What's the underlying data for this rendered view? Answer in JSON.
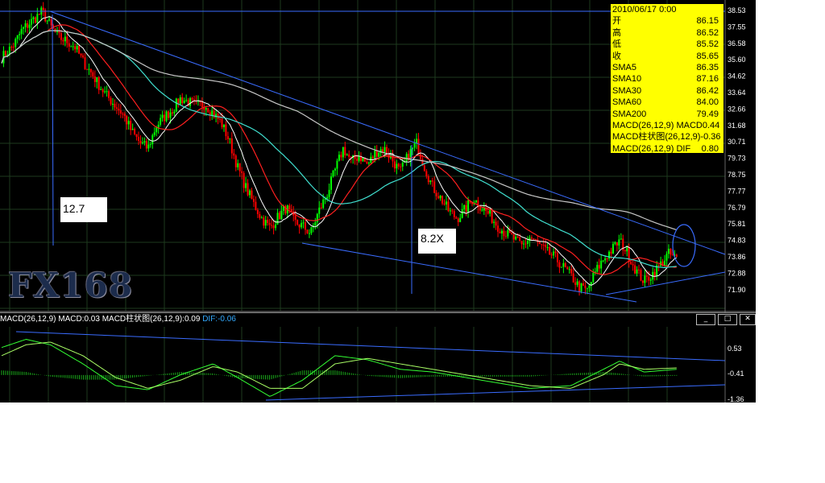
{
  "info_panel": {
    "date": "2010/06/17 0:00",
    "rows": [
      {
        "label": "开",
        "value": "86.15"
      },
      {
        "label": "高",
        "value": "86.52"
      },
      {
        "label": "低",
        "value": "85.52"
      },
      {
        "label": "收",
        "value": "85.65"
      },
      {
        "label": "SMA5",
        "value": "86.35"
      },
      {
        "label": "SMA10",
        "value": "87.16"
      },
      {
        "label": "SMA30",
        "value": "86.42"
      },
      {
        "label": "SMA60",
        "value": "84.00"
      },
      {
        "label": "SMA200",
        "value": "79.49"
      },
      {
        "label": "MACD(26,12,9) MACD",
        "value": "0.44"
      },
      {
        "label": "MACD柱状图(26,12,9)",
        "value": "-0.36"
      },
      {
        "label": "MACD(26,12,9) DIF",
        "value": "0.80"
      }
    ]
  },
  "annotations": {
    "left_note": "12.7",
    "right_note": "8.2X"
  },
  "logo_text": "FX168",
  "macd_header": {
    "main": "MACD(26,12,9) MACD:0.03 MACD柱状图(26,12,9):0.09",
    "dif": "DIF:-0.06"
  },
  "window_buttons": {
    "minimize": "_",
    "maximize": "□",
    "close": "✕"
  },
  "colors": {
    "background": "#000000",
    "up": "#00ff00",
    "down": "#ff0000",
    "sma5": "#ffffff",
    "sma10": "#ff2020",
    "sma30": "#40e0d0",
    "sma200": "#c8c8c8",
    "trendline": "#3a6cff",
    "info_bg": "#ffff00"
  },
  "chart_data": [
    {
      "type": "candlestick",
      "series": [
        "SMA5",
        "SMA10",
        "SMA30",
        "SMA200"
      ],
      "y_ticks": [
        "38.53",
        "37.55",
        "36.58",
        "35.60",
        "34.62",
        "33.64",
        "32.66",
        "31.68",
        "30.71",
        "79.73",
        "78.75",
        "77.77",
        "76.79",
        "75.81",
        "74.83",
        "73.86",
        "72.88",
        "71.90"
      ],
      "x_range": [
        0,
        170
      ],
      "ylim": [
        71.9,
        88.1
      ],
      "close_path": [
        [
          0,
          85.5
        ],
        [
          3,
          86.2
        ],
        [
          5,
          87.0
        ],
        [
          8,
          87.6
        ],
        [
          10,
          88.0
        ],
        [
          12,
          87.2
        ],
        [
          14,
          86.6
        ],
        [
          16,
          86.4
        ],
        [
          18,
          86.1
        ],
        [
          20,
          85.3
        ],
        [
          22,
          84.7
        ],
        [
          24,
          84.0
        ],
        [
          26,
          83.4
        ],
        [
          28,
          82.9
        ],
        [
          30,
          82.4
        ],
        [
          32,
          81.5
        ],
        [
          34,
          80.9
        ],
        [
          36,
          80.6
        ],
        [
          38,
          81.8
        ],
        [
          40,
          82.3
        ],
        [
          42,
          82.7
        ],
        [
          44,
          83.3
        ],
        [
          46,
          83.1
        ],
        [
          48,
          82.9
        ],
        [
          50,
          83.0
        ],
        [
          52,
          82.5
        ],
        [
          54,
          82.0
        ],
        [
          56,
          81.0
        ],
        [
          58,
          79.6
        ],
        [
          60,
          78.5
        ],
        [
          62,
          77.6
        ],
        [
          64,
          76.8
        ],
        [
          66,
          76.3
        ],
        [
          68,
          76.9
        ],
        [
          70,
          77.4
        ],
        [
          72,
          76.6
        ],
        [
          74,
          76.4
        ],
        [
          76,
          76.0
        ],
        [
          78,
          77.2
        ],
        [
          80,
          78.1
        ],
        [
          82,
          79.4
        ],
        [
          84,
          80.6
        ],
        [
          86,
          79.9
        ],
        [
          88,
          80.2
        ],
        [
          90,
          79.7
        ],
        [
          92,
          80.4
        ],
        [
          94,
          80.6
        ],
        [
          96,
          80.0
        ],
        [
          98,
          79.3
        ],
        [
          100,
          80.2
        ],
        [
          102,
          80.9
        ],
        [
          104,
          79.6
        ],
        [
          106,
          78.5
        ],
        [
          108,
          77.9
        ],
        [
          110,
          77.2
        ],
        [
          112,
          76.8
        ],
        [
          114,
          77.3
        ],
        [
          116,
          77.9
        ],
        [
          118,
          77.4
        ],
        [
          120,
          77.0
        ],
        [
          122,
          76.4
        ],
        [
          124,
          76.0
        ],
        [
          126,
          75.7
        ],
        [
          128,
          75.3
        ],
        [
          130,
          75.8
        ],
        [
          132,
          75.4
        ],
        [
          134,
          75.0
        ],
        [
          136,
          74.7
        ],
        [
          138,
          74.2
        ],
        [
          140,
          73.7
        ],
        [
          142,
          73.1
        ],
        [
          144,
          72.9
        ],
        [
          146,
          73.9
        ],
        [
          148,
          74.6
        ],
        [
          150,
          75.1
        ],
        [
          152,
          75.6
        ],
        [
          154,
          74.9
        ],
        [
          156,
          74.0
        ],
        [
          158,
          73.4
        ],
        [
          160,
          73.8
        ],
        [
          162,
          74.3
        ],
        [
          164,
          74.9
        ],
        [
          166,
          74.6
        ]
      ]
    },
    {
      "type": "macd",
      "y_ticks": [
        "0.53",
        "-0.41",
        "-1.36"
      ],
      "ylim": [
        -1.36,
        1.3
      ],
      "macd_path": [
        [
          0,
          0.6
        ],
        [
          6,
          0.9
        ],
        [
          12,
          0.7
        ],
        [
          20,
          0.0
        ],
        [
          28,
          -0.8
        ],
        [
          36,
          -0.95
        ],
        [
          44,
          -0.4
        ],
        [
          52,
          0.0
        ],
        [
          58,
          -0.5
        ],
        [
          66,
          -1.2
        ],
        [
          74,
          -0.6
        ],
        [
          82,
          0.3
        ],
        [
          90,
          0.15
        ],
        [
          98,
          -0.2
        ],
        [
          106,
          -0.3
        ],
        [
          114,
          -0.5
        ],
        [
          122,
          -0.7
        ],
        [
          130,
          -0.9
        ],
        [
          140,
          -0.8
        ],
        [
          148,
          -0.2
        ],
        [
          152,
          0.1
        ],
        [
          158,
          -0.3
        ],
        [
          166,
          -0.2
        ]
      ],
      "dif_path": [
        [
          0,
          0.3
        ],
        [
          6,
          0.7
        ],
        [
          12,
          0.8
        ],
        [
          20,
          0.3
        ],
        [
          28,
          -0.5
        ],
        [
          36,
          -0.9
        ],
        [
          44,
          -0.6
        ],
        [
          52,
          -0.1
        ],
        [
          58,
          -0.3
        ],
        [
          66,
          -0.9
        ],
        [
          74,
          -0.9
        ],
        [
          82,
          0.0
        ],
        [
          90,
          0.2
        ],
        [
          98,
          0.0
        ],
        [
          106,
          -0.2
        ],
        [
          114,
          -0.4
        ],
        [
          122,
          -0.6
        ],
        [
          130,
          -0.8
        ],
        [
          140,
          -0.9
        ],
        [
          148,
          -0.4
        ],
        [
          152,
          0.0
        ],
        [
          158,
          -0.2
        ],
        [
          166,
          -0.15
        ]
      ]
    }
  ]
}
